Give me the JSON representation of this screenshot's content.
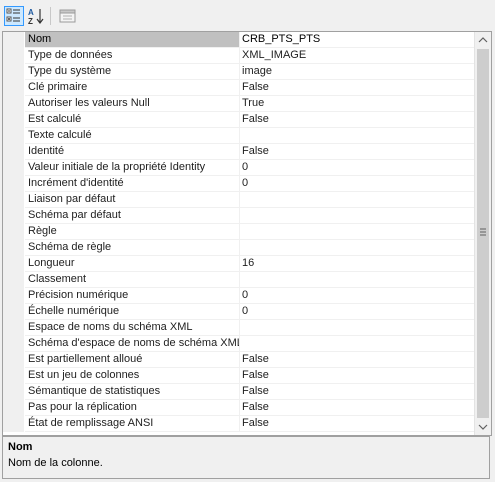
{
  "toolbar": {
    "categorized_icon": "categorized-view-icon",
    "alphabetical_icon": "sort-az-icon",
    "property_pages_icon": "property-pages-icon"
  },
  "properties": [
    {
      "name": "Nom",
      "value": "CRB_PTS_PTS"
    },
    {
      "name": "Type de données",
      "value": "XML_IMAGE"
    },
    {
      "name": "Type du système",
      "value": "image"
    },
    {
      "name": "Clé primaire",
      "value": "False"
    },
    {
      "name": "Autoriser les valeurs Null",
      "value": "True"
    },
    {
      "name": "Est calculé",
      "value": "False"
    },
    {
      "name": "Texte calculé",
      "value": ""
    },
    {
      "name": "Identité",
      "value": "False"
    },
    {
      "name": "Valeur initiale de la propriété Identity",
      "value": "0"
    },
    {
      "name": "Incrément d'identité",
      "value": "0"
    },
    {
      "name": "Liaison par défaut",
      "value": ""
    },
    {
      "name": "Schéma par défaut",
      "value": ""
    },
    {
      "name": "Règle",
      "value": ""
    },
    {
      "name": "Schéma de règle",
      "value": ""
    },
    {
      "name": "Longueur",
      "value": "16"
    },
    {
      "name": "Classement",
      "value": ""
    },
    {
      "name": "Précision numérique",
      "value": "0"
    },
    {
      "name": "Échelle numérique",
      "value": "0"
    },
    {
      "name": "Espace de noms du schéma XML",
      "value": ""
    },
    {
      "name": "Schéma d'espace de noms de schéma XML",
      "value": ""
    },
    {
      "name": "Est partiellement alloué",
      "value": "False"
    },
    {
      "name": "Est un jeu de colonnes",
      "value": "False"
    },
    {
      "name": "Sémantique de statistiques",
      "value": "False"
    },
    {
      "name": "Pas pour la réplication",
      "value": "False"
    },
    {
      "name": "État de remplissage ANSI",
      "value": "False"
    }
  ],
  "selected_index": 0,
  "description": {
    "title": "Nom",
    "text": "Nom de la colonne."
  },
  "colors": {
    "selected_row": "#c0c0c0",
    "toolbar_active": "#cce8ff",
    "gridline": "#f0f0f0"
  }
}
